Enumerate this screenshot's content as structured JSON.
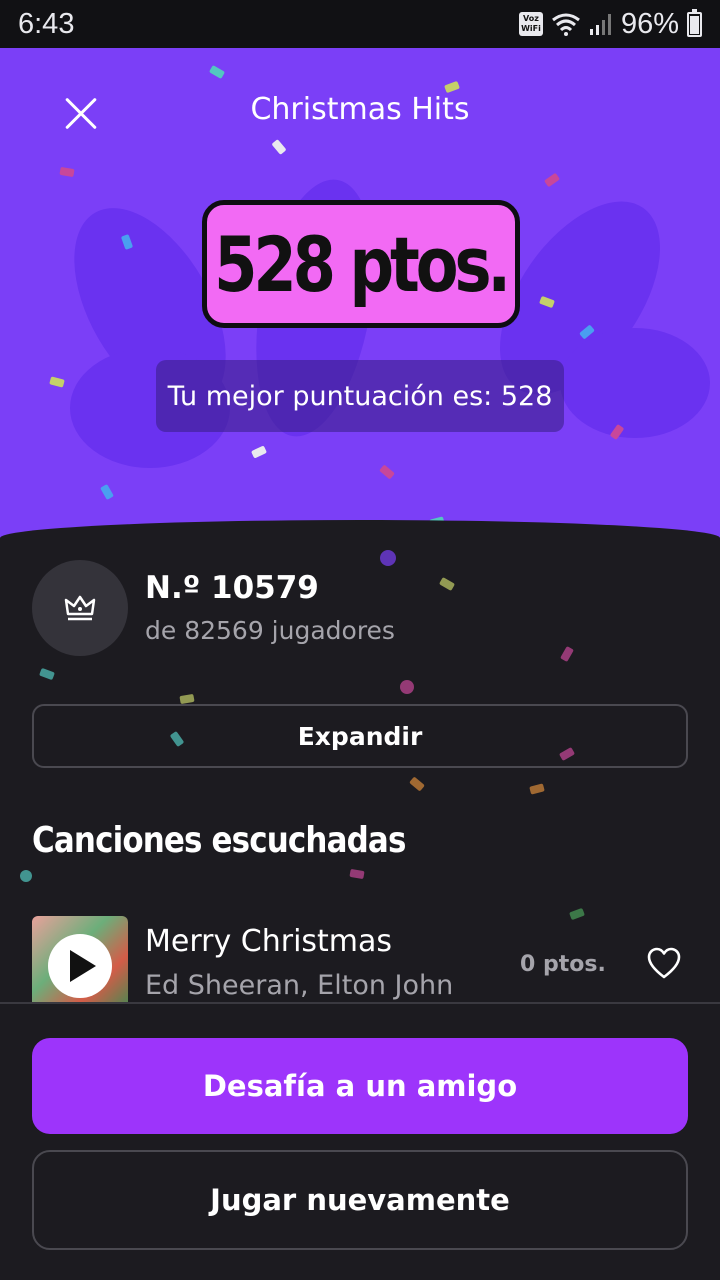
{
  "status_bar": {
    "time": "6:43",
    "voz_label_top": "Voz",
    "voz_label_bottom": "WiFi",
    "battery": "96%"
  },
  "header": {
    "title": "Christmas Hits",
    "close_icon": "close-icon"
  },
  "score": {
    "text": "528 ptos.",
    "best_text": "Tu mejor puntuación es: 528"
  },
  "ranking": {
    "position": "N.º 10579",
    "subtitle": "de 82569 jugadores",
    "icon": "crown-icon"
  },
  "expand_label": "Expandir",
  "songs_section": {
    "title": "Canciones escuchadas",
    "items": [
      {
        "title": "Merry Christmas",
        "artist": "Ed Sheeran, Elton John",
        "points": "0 ptos."
      }
    ]
  },
  "actions": {
    "challenge_label": "Desafía a un amigo",
    "replay_label": "Jugar nuevamente"
  },
  "colors": {
    "hero_bg": "#7b3ff7",
    "score_pill": "#f26af4",
    "primary_button": "#9d34fb",
    "panel_bg": "#1c1b20"
  }
}
